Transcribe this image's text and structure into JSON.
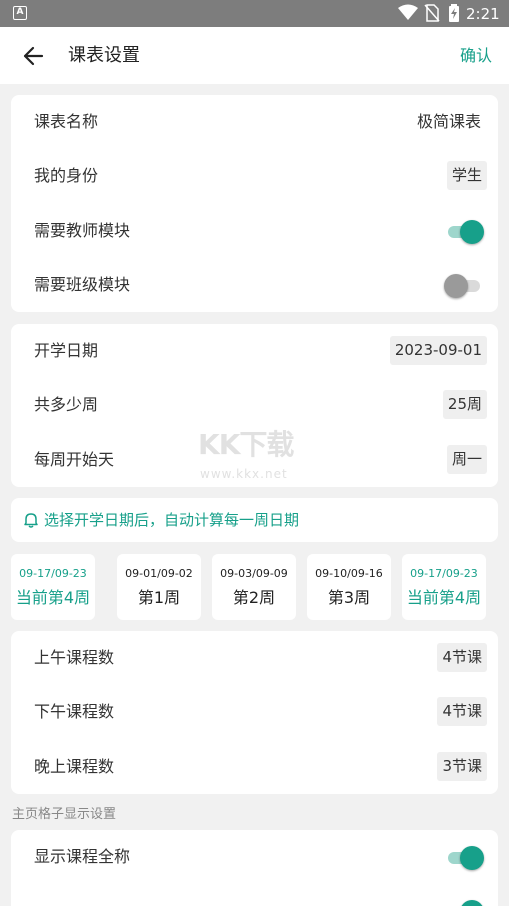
{
  "status_bar": {
    "time": "2:21",
    "app_indicator": "A"
  },
  "app_bar": {
    "title": "课表设置",
    "confirm_label": "确认"
  },
  "basic": {
    "name_label": "课表名称",
    "name_value": "极简课表",
    "identity_label": "我的身份",
    "identity_value": "学生",
    "teacher_label": "需要教师模块",
    "teacher_on": true,
    "class_label": "需要班级模块",
    "class_on": false
  },
  "term": {
    "start_label": "开学日期",
    "start_value": "2023-09-01",
    "weeks_label": "共多少周",
    "weeks_value": "25周",
    "week_start_label": "每周开始天",
    "week_start_value": "周一"
  },
  "notice": {
    "text": "选择开学日期后，自动计算每一周日期",
    "icon": "bell-icon"
  },
  "weeks": [
    {
      "range": "09-17/09-23",
      "label": "当前第4周",
      "current": true
    },
    {
      "range": "09-01/09-02",
      "label": "第1周",
      "current": false
    },
    {
      "range": "09-03/09-09",
      "label": "第2周",
      "current": false
    },
    {
      "range": "09-10/09-16",
      "label": "第3周",
      "current": false
    },
    {
      "range": "09-17/09-23",
      "label": "当前第4周",
      "current": true
    }
  ],
  "lessons": {
    "morning_label": "上午课程数",
    "morning_value": "4节课",
    "afternoon_label": "下午课程数",
    "afternoon_value": "4节课",
    "evening_label": "晚上课程数",
    "evening_value": "3节课"
  },
  "grid_settings": {
    "section_title": "主页格子显示设置",
    "full_name_label": "显示课程全称",
    "full_name_on": true,
    "second_toggle_on": true
  },
  "watermark": {
    "big": "KK下载",
    "small": "www.kkx.net"
  },
  "colors": {
    "accent": "#17a08a",
    "background": "#f1f1f1",
    "status_bar": "#7d7d7d"
  }
}
